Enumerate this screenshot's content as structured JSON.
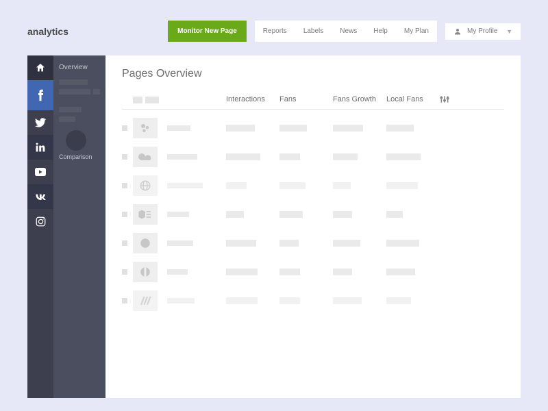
{
  "brand": "analytics",
  "monitor_button": "Monitor New Page",
  "nav": [
    "Reports",
    "Labels",
    "News",
    "Help",
    "My Plan"
  ],
  "profile": {
    "label": "My Profile"
  },
  "sidebar": {
    "overview": "Overview",
    "comparison": "Comparison"
  },
  "page_title": "Pages Overview",
  "columns": {
    "interactions": "Interactions",
    "fans": "Fans",
    "fans_growth": "Fans Growth",
    "local_fans": "Local Fans"
  }
}
